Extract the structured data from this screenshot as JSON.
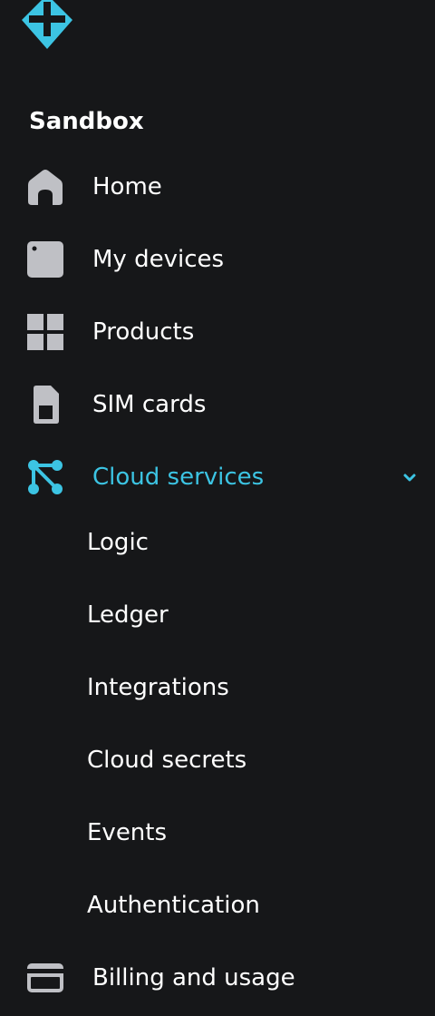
{
  "workspace": {
    "name": "Sandbox"
  },
  "colors": {
    "background": "#161719",
    "icon_gray": "#bfc0c5",
    "accent": "#3cc4e3"
  },
  "nav": {
    "items": [
      {
        "label": "Home",
        "icon": "home-icon"
      },
      {
        "label": "My devices",
        "icon": "device-icon"
      },
      {
        "label": "Products",
        "icon": "grid-icon"
      },
      {
        "label": "SIM cards",
        "icon": "sim-card-icon"
      },
      {
        "label": "Cloud services",
        "icon": "cloud-services-icon",
        "active": true,
        "expanded": true
      },
      {
        "label": "Billing and usage",
        "icon": "credit-card-icon"
      }
    ],
    "cloud_services_children": [
      {
        "label": "Logic"
      },
      {
        "label": "Ledger"
      },
      {
        "label": "Integrations"
      },
      {
        "label": "Cloud secrets"
      },
      {
        "label": "Events"
      },
      {
        "label": "Authentication"
      }
    ]
  }
}
